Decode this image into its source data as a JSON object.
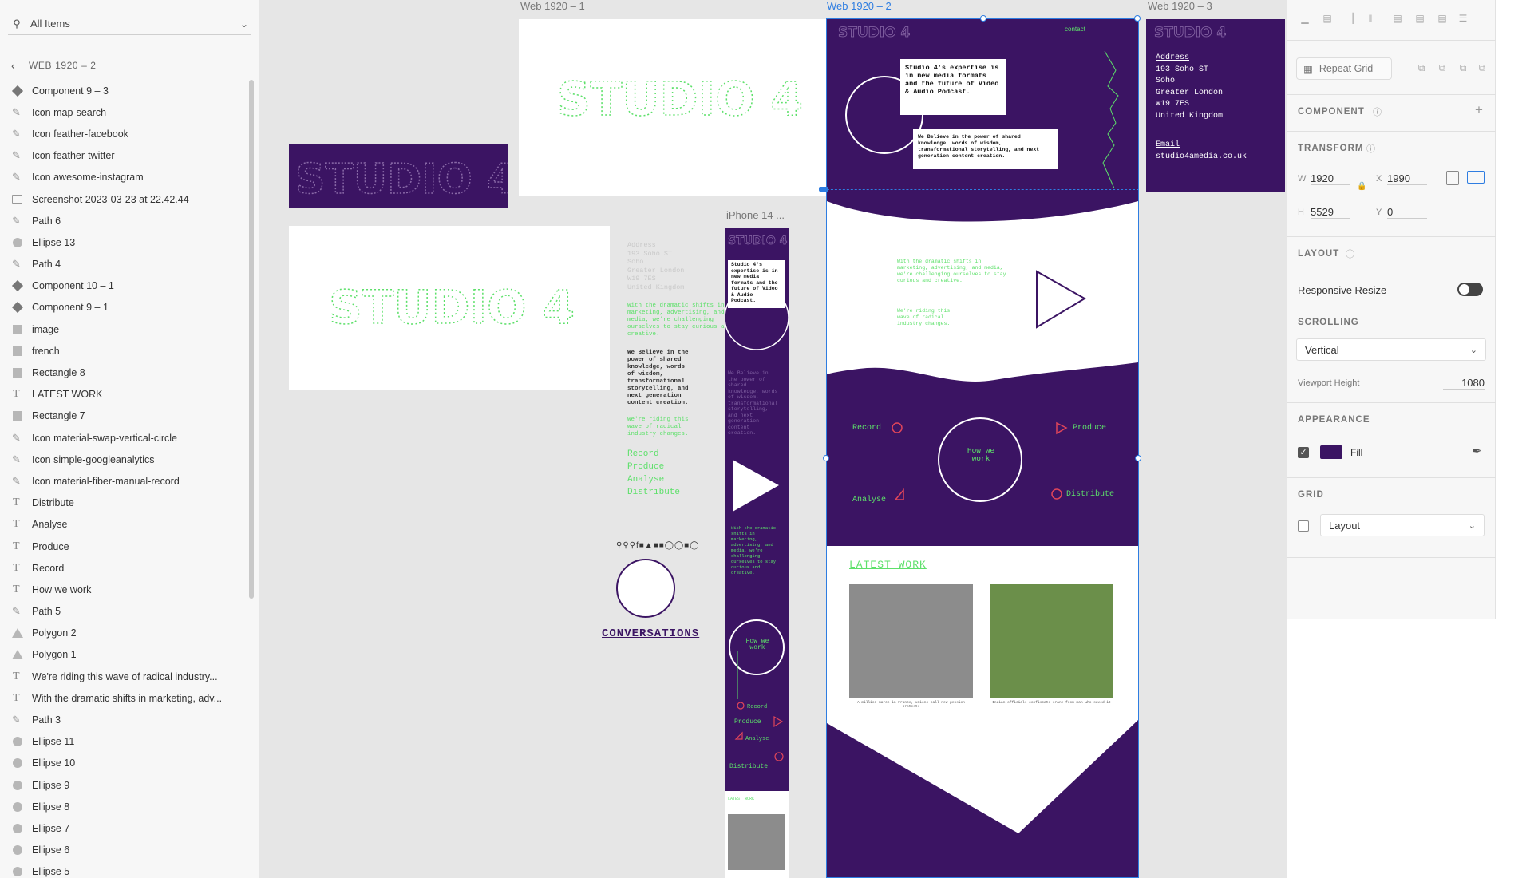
{
  "layers_panel": {
    "search_text": "All Items",
    "breadcrumb": "WEB 1920 – 2",
    "items": [
      {
        "label": "Component 9 – 3",
        "icon": "component-icon"
      },
      {
        "label": "Icon map-search",
        "icon": "path-icon"
      },
      {
        "label": "Icon feather-facebook",
        "icon": "path-icon"
      },
      {
        "label": "Icon feather-twitter",
        "icon": "path-icon"
      },
      {
        "label": "Icon awesome-instagram",
        "icon": "path-icon"
      },
      {
        "label": "Screenshot 2023-03-23 at 22.42.44",
        "icon": "image-icon"
      },
      {
        "label": "Path 6",
        "icon": "path-icon"
      },
      {
        "label": "Ellipse 13",
        "icon": "ellipse-icon"
      },
      {
        "label": "Path 4",
        "icon": "path-icon"
      },
      {
        "label": "Component 10 – 1",
        "icon": "component-icon"
      },
      {
        "label": "Component 9 – 1",
        "icon": "component-icon"
      },
      {
        "label": "image",
        "icon": "rectangle-icon"
      },
      {
        "label": "french",
        "icon": "rectangle-icon"
      },
      {
        "label": "Rectangle 8",
        "icon": "rectangle-icon"
      },
      {
        "label": "LATEST WORK",
        "icon": "text-icon"
      },
      {
        "label": "Rectangle 7",
        "icon": "rectangle-icon"
      },
      {
        "label": "Icon material-swap-vertical-circle",
        "icon": "path-icon"
      },
      {
        "label": "Icon simple-googleanalytics",
        "icon": "path-icon"
      },
      {
        "label": "Icon material-fiber-manual-record",
        "icon": "path-icon"
      },
      {
        "label": "Distribute",
        "icon": "text-icon"
      },
      {
        "label": "Analyse",
        "icon": "text-icon"
      },
      {
        "label": "Produce",
        "icon": "text-icon"
      },
      {
        "label": "Record",
        "icon": "text-icon"
      },
      {
        "label": "How we work",
        "icon": "text-icon"
      },
      {
        "label": "Path 5",
        "icon": "path-icon"
      },
      {
        "label": "Polygon 2",
        "icon": "polygon-icon"
      },
      {
        "label": "Polygon 1",
        "icon": "polygon-icon"
      },
      {
        "label": "We're riding this wave of radical industry...",
        "icon": "text-icon"
      },
      {
        "label": "With the dramatic shifts in marketing, adv...",
        "icon": "text-icon"
      },
      {
        "label": "Path 3",
        "icon": "path-icon"
      },
      {
        "label": "Ellipse 11",
        "icon": "ellipse-icon"
      },
      {
        "label": "Ellipse 10",
        "icon": "ellipse-icon"
      },
      {
        "label": "Ellipse 9",
        "icon": "ellipse-icon"
      },
      {
        "label": "Ellipse 8",
        "icon": "ellipse-icon"
      },
      {
        "label": "Ellipse 7",
        "icon": "ellipse-icon"
      },
      {
        "label": "Ellipse 6",
        "icon": "ellipse-icon"
      },
      {
        "label": "Ellipse 5",
        "icon": "ellipse-icon"
      }
    ]
  },
  "canvas": {
    "artboard_labels": {
      "web1": "Web 1920 – 1",
      "web2": "Web 1920 – 2",
      "web3": "Web 1920 – 3",
      "iphone": "iPhone 14 ..."
    },
    "brand": "STUDIO 4",
    "contact": "contact",
    "expertise": "Studio 4's expertise is in new media formats and the future of Video & Audio Podcast.",
    "believe": "We Believe in the power of shared knowledge, words of wisdom, transformational storytelling, and next generation content creation.",
    "believe_short": "We Believe in the power of shared knowledge, words of wisdom, transformational storytelling, and next generation content creation.",
    "shifts": "With the dramatic shifts in marketing, advertising, and media, we're challenging ourselves to stay curious and creative.",
    "riding": "We're riding this wave of radical industry changes.",
    "how_we_work": "How we work",
    "record": "Record",
    "produce": "Produce",
    "analyse": "Analyse",
    "distribute": "Distribute",
    "latest_work": "LATEST WORK",
    "latest_short": "LATEST WORK",
    "caption1": "A million march in France, unions call new pension protests",
    "caption2": "Indian officials confiscate crane from man who saved it",
    "conversations": "CONVERSATIONS",
    "address_label": "Address",
    "address_lines": [
      "193 Soho ST",
      "Soho",
      "Greater London",
      "W19 7ES",
      "United Kingdom"
    ],
    "email_label": "Email",
    "email": "studio4amedia.co.uk",
    "colors": {
      "purple": "#3b1463",
      "green": "#5de06a",
      "red": "#e0455a",
      "selection": "#2e7de1"
    }
  },
  "properties": {
    "repeat_grid": "Repeat Grid",
    "component_label": "COMPONENT",
    "transform_label": "TRANSFORM",
    "w_label": "W",
    "w_value": "1920",
    "x_label": "X",
    "x_value": "1990",
    "h_label": "H",
    "h_value": "5529",
    "y_label": "Y",
    "y_value": "0",
    "layout_label": "LAYOUT",
    "responsive_resize": "Responsive Resize",
    "scrolling_label": "SCROLLING",
    "scrolling_value": "Vertical",
    "viewport_label": "Viewport Height",
    "viewport_value": "1080",
    "appearance_label": "APPEARANCE",
    "fill_label": "Fill",
    "fill_color": "#3b1463",
    "grid_label": "GRID",
    "grid_value": "Layout"
  }
}
